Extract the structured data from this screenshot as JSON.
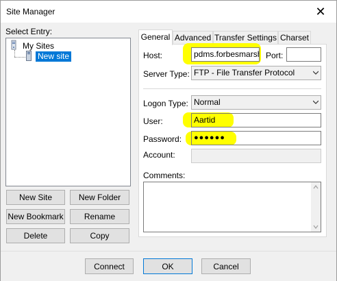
{
  "window": {
    "title": "Site Manager",
    "close_glyph": "✕"
  },
  "select_entry_label": "Select Entry:",
  "tree": {
    "root": {
      "label": "My Sites",
      "icon": "folder-icon"
    },
    "child": {
      "label": "New site",
      "icon": "server-icon"
    }
  },
  "left_buttons": {
    "new_site": "New Site",
    "new_folder": "New Folder",
    "new_bookmark": "New Bookmark",
    "rename": "Rename",
    "delete": "Delete",
    "copy": "Copy"
  },
  "tabs": [
    "General",
    "Advanced",
    "Transfer Settings",
    "Charset"
  ],
  "general": {
    "host_label": "Host:",
    "host_value": "pdms.forbesmarsha",
    "port_label": "Port:",
    "port_value": "",
    "server_type_label": "Server Type:",
    "server_type_value": "FTP - File Transfer Protocol",
    "logon_type_label": "Logon Type:",
    "logon_type_value": "Normal",
    "user_label": "User:",
    "user_value": "Aartid",
    "password_label": "Password:",
    "password_value": "●●●●●●",
    "account_label": "Account:",
    "account_value": "",
    "comments_label": "Comments:",
    "comments_value": ""
  },
  "footer": {
    "connect": "Connect",
    "ok": "OK",
    "cancel": "Cancel"
  },
  "colors": {
    "highlight": "#ffff00",
    "selection": "#0078d7"
  }
}
